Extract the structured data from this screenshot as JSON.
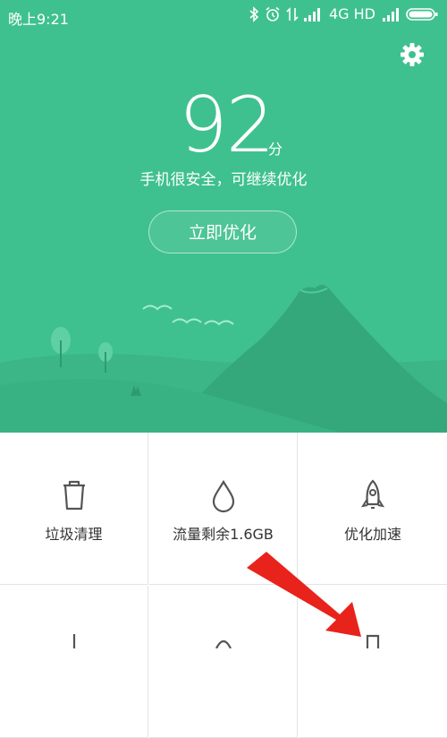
{
  "status_bar": {
    "time": "晚上9:21",
    "network": "4G HD"
  },
  "hero": {
    "score": "92",
    "score_unit": "分",
    "subtitle": "手机很安全，可继续优化",
    "optimize_button": "立即优化",
    "background_color": "#3fc18f"
  },
  "tools": [
    {
      "label": "垃圾清理",
      "icon": "trash-icon"
    },
    {
      "label": "流量剩余1.6GB",
      "icon": "water-drop-icon"
    },
    {
      "label": "优化加速",
      "icon": "rocket-icon"
    }
  ],
  "overlay": {
    "arrow_color": "#e8231c"
  }
}
